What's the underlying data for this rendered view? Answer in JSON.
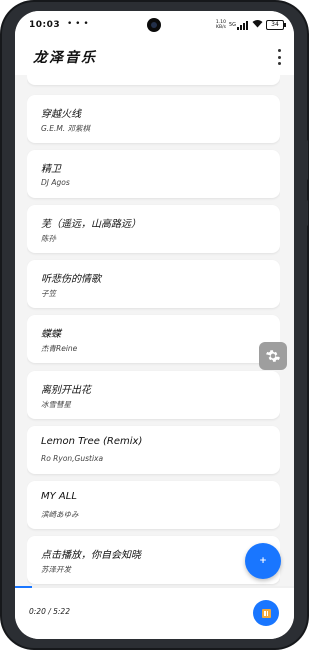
{
  "status_bar": {
    "time": "10:03",
    "dots": "• • •",
    "net_speed_top": "1.10",
    "net_speed_bottom": "KB/s",
    "net_type": "5G",
    "battery": "34"
  },
  "app": {
    "title": "龙泽音乐"
  },
  "songs": [
    {
      "title": "",
      "artist": ""
    },
    {
      "title": "穿越火线",
      "artist": "G.E.M. 邓紫棋"
    },
    {
      "title": "精卫",
      "artist": "DJ Agos"
    },
    {
      "title": "芜（遥远，山高路远）",
      "artist": "陈孙"
    },
    {
      "title": "听悲伤的情歌",
      "artist": "子笠"
    },
    {
      "title": "蝶蝶",
      "artist": "杰青Reine"
    },
    {
      "title": "离别开出花",
      "artist": "冰雪彗星"
    },
    {
      "title": "Lemon Tree (Remix)",
      "artist": "Ro Ryon,Gustixa"
    },
    {
      "title": "MY ALL",
      "artist": "滨崎あゆみ"
    },
    {
      "title": "点击播放，你自会知晓",
      "artist": "苏泽开发"
    }
  ],
  "fab": {
    "add_label": "+"
  },
  "player": {
    "time": "0:20 / 5:22",
    "progress": 0.062
  },
  "colors": {
    "accent": "#1976ff",
    "pause_inner": "#f2a93b",
    "settings_fab": "#9e9e9e"
  },
  "icons": {
    "settings": "gear-icon",
    "menu": "more-vertical-icon",
    "pause": "pause-icon",
    "add": "plus-icon"
  }
}
